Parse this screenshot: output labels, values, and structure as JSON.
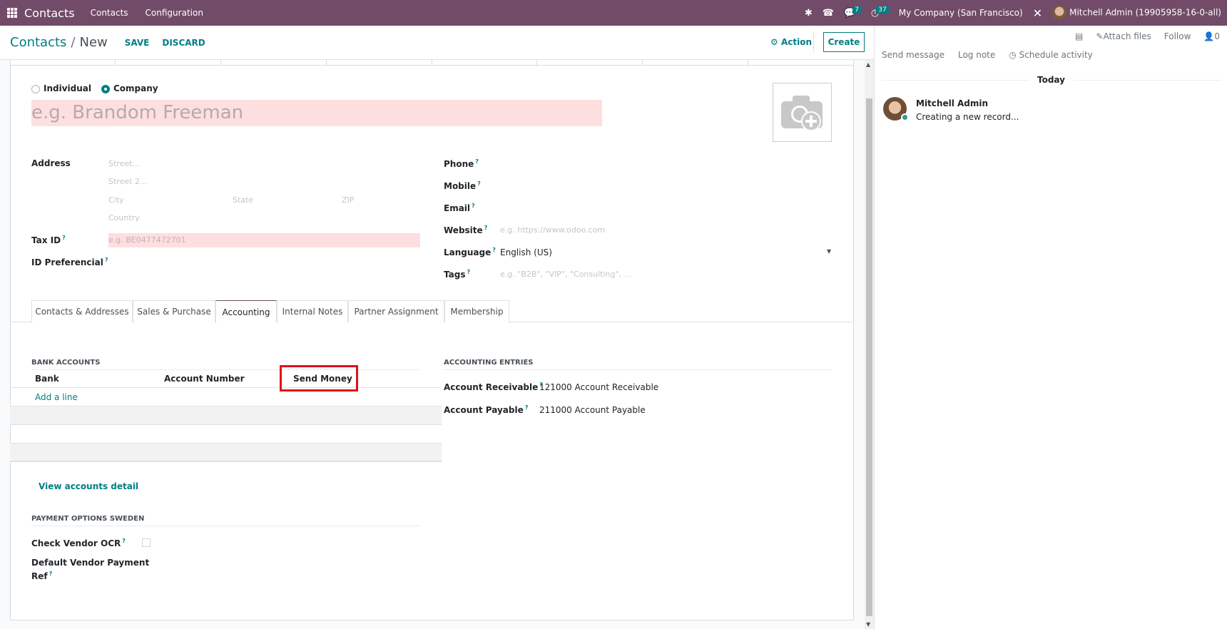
{
  "navbar": {
    "app_name": "Contacts",
    "menus": [
      "Contacts",
      "Configuration"
    ],
    "icons": [
      "bug-icon",
      "phone-icon",
      "chat-icon",
      "clock-icon",
      "tools-icon"
    ],
    "messages_count": "7",
    "activities_count": "37",
    "company": "My Company (San Francisco)",
    "user": "Mitchell Admin (19905958-16-0-all)"
  },
  "control_panel": {
    "breadcrumb_parent": "Contacts",
    "breadcrumb_separator": "/",
    "breadcrumb_current": "New",
    "save_label": "SAVE",
    "discard_label": "DISCARD",
    "action_label": "Action",
    "create_label": "Create"
  },
  "form": {
    "type_individual": "Individual",
    "type_company": "Company",
    "selected_type": "Company",
    "name_placeholder": "e.g. Brandom Freeman",
    "address_label": "Address",
    "street_placeholder": "Street...",
    "street2_placeholder": "Street 2...",
    "city_placeholder": "City",
    "state_placeholder": "State",
    "zip_placeholder": "ZIP",
    "country_placeholder": "Country",
    "taxid_label": "Tax ID",
    "taxid_placeholder": "e.g. BE0477472701",
    "idpref_label": "ID Preferencial",
    "phone_label": "Phone",
    "mobile_label": "Mobile",
    "email_label": "Email",
    "website_label": "Website",
    "website_placeholder": "e.g. https://www.odoo.com",
    "language_label": "Language",
    "language_value": "English (US)",
    "tags_label": "Tags",
    "tags_placeholder": "e.g. \"B2B\", \"VIP\", \"Consulting\", ...",
    "help_mark": "?"
  },
  "tabs": [
    {
      "label": "Contacts & Addresses",
      "active": false
    },
    {
      "label": "Sales & Purchase",
      "active": false
    },
    {
      "label": "Accounting",
      "active": true
    },
    {
      "label": "Internal Notes",
      "active": false
    },
    {
      "label": "Partner Assignment",
      "active": false
    },
    {
      "label": "Membership",
      "active": false
    }
  ],
  "accounting": {
    "bank_accounts_title": "BANK ACCOUNTS",
    "columns": [
      "Bank",
      "Account Number",
      "Send Money"
    ],
    "add_line": "Add a line",
    "entries_title": "ACCOUNTING ENTRIES",
    "receivable_label": "Account Receivable",
    "receivable_value": "121000 Account Receivable",
    "payable_label": "Account Payable",
    "payable_value": "211000 Account Payable",
    "view_accounts": "View accounts detail",
    "sweden_title": "PAYMENT OPTIONS SWEDEN",
    "check_ocr_label": "Check Vendor OCR",
    "check_ocr_checked": false,
    "vendor_ref_label_1": "Default Vendor Payment",
    "vendor_ref_label_2": "Ref"
  },
  "chatter": {
    "attach_files": "Attach files",
    "follow": "Follow",
    "followers_count": "0",
    "send_message": "Send message",
    "log_note": "Log note",
    "schedule_activity": "Schedule activity",
    "date_separator": "Today",
    "messages": [
      {
        "author": "Mitchell Admin",
        "body": "Creating a new record..."
      }
    ]
  },
  "colors": {
    "navbar": "#714b67",
    "accent": "#017e84",
    "required_field": "#fddfe0",
    "highlight_box": "#e0101a"
  }
}
